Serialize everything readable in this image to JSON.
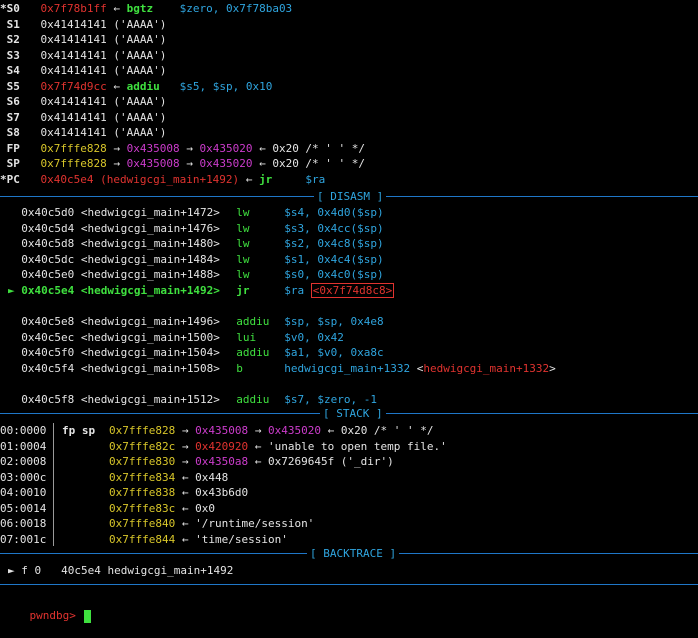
{
  "registers": [
    {
      "name": "*S0",
      "value": "0x7f78b1ff",
      "vcolor": "red",
      "rest": [
        {
          "t": " ← ",
          "c": "white"
        },
        {
          "t": "bgtz",
          "c": "green"
        },
        {
          "t": "    $zero, 0x7f78ba03",
          "c": "cyan"
        }
      ]
    },
    {
      "name": " S1",
      "value": "0x41414141 ('AAAA')",
      "vcolor": "white",
      "rest": []
    },
    {
      "name": " S2",
      "value": "0x41414141 ('AAAA')",
      "vcolor": "white",
      "rest": []
    },
    {
      "name": " S3",
      "value": "0x41414141 ('AAAA')",
      "vcolor": "white",
      "rest": []
    },
    {
      "name": " S4",
      "value": "0x41414141 ('AAAA')",
      "vcolor": "white",
      "rest": []
    },
    {
      "name": " S5",
      "value": "0x7f74d9cc",
      "vcolor": "red",
      "rest": [
        {
          "t": " ← ",
          "c": "white"
        },
        {
          "t": "addiu",
          "c": "green"
        },
        {
          "t": "   $s5, $sp, 0x10",
          "c": "cyan"
        }
      ]
    },
    {
      "name": " S6",
      "value": "0x41414141 ('AAAA')",
      "vcolor": "white",
      "rest": []
    },
    {
      "name": " S7",
      "value": "0x41414141 ('AAAA')",
      "vcolor": "white",
      "rest": []
    },
    {
      "name": " S8",
      "value": "0x41414141 ('AAAA')",
      "vcolor": "white",
      "rest": []
    },
    {
      "name": " FP",
      "value": "0x7fffe828",
      "vcolor": "yellow",
      "rest": [
        {
          "t": " → ",
          "c": "white"
        },
        {
          "t": "0x435008",
          "c": "magenta"
        },
        {
          "t": " → ",
          "c": "white"
        },
        {
          "t": "0x435020",
          "c": "magenta"
        },
        {
          "t": " ← 0x20 /* ' ' */",
          "c": "white"
        }
      ]
    },
    {
      "name": " SP",
      "value": "0x7fffe828",
      "vcolor": "yellow",
      "rest": [
        {
          "t": " → ",
          "c": "white"
        },
        {
          "t": "0x435008",
          "c": "magenta"
        },
        {
          "t": " → ",
          "c": "white"
        },
        {
          "t": "0x435020",
          "c": "magenta"
        },
        {
          "t": " ← 0x20 /* ' ' */",
          "c": "white"
        }
      ]
    },
    {
      "name": "*PC",
      "value": "0x40c5e4 (hedwigcgi_main+1492)",
      "vcolor": "red",
      "rest": [
        {
          "t": " ← ",
          "c": "white"
        },
        {
          "t": "jr",
          "c": "green"
        },
        {
          "t": "     $ra",
          "c": "cyan"
        }
      ]
    }
  ],
  "sections": {
    "disasm": "[ DISASM ]",
    "stack": "[ STACK ]",
    "backtrace": "[ BACKTRACE ]"
  },
  "disasm": [
    {
      "marker": "  ",
      "addr": "0x40c5d0 <hedwigcgi_main+1472>",
      "mn": "lw",
      "ops": "$s4, 0x4d0($sp)",
      "current": false
    },
    {
      "marker": "  ",
      "addr": "0x40c5d4 <hedwigcgi_main+1476>",
      "mn": "lw",
      "ops": "$s3, 0x4cc($sp)",
      "current": false
    },
    {
      "marker": "  ",
      "addr": "0x40c5d8 <hedwigcgi_main+1480>",
      "mn": "lw",
      "ops": "$s2, 0x4c8($sp)",
      "current": false
    },
    {
      "marker": "  ",
      "addr": "0x40c5dc <hedwigcgi_main+1484>",
      "mn": "lw",
      "ops": "$s1, 0x4c4($sp)",
      "current": false
    },
    {
      "marker": "  ",
      "addr": "0x40c5e0 <hedwigcgi_main+1488>",
      "mn": "lw",
      "ops": "$s0, 0x4c0($sp)",
      "current": false
    },
    {
      "marker": "► ",
      "addr": "0x40c5e4 <hedwigcgi_main+1492>",
      "mn": "jr",
      "ops": "$ra ",
      "target": "<0x7f74d8c8>",
      "current": true
    },
    {
      "marker": "",
      "addr": "",
      "mn": "",
      "ops": "",
      "current": false
    },
    {
      "marker": "  ",
      "addr": "0x40c5e8 <hedwigcgi_main+1496>",
      "mn": "addiu",
      "ops": "$sp, $sp, 0x4e8",
      "current": false
    },
    {
      "marker": "  ",
      "addr": "0x40c5ec <hedwigcgi_main+1500>",
      "mn": "lui",
      "ops": "$v0, 0x42",
      "current": false
    },
    {
      "marker": "  ",
      "addr": "0x40c5f0 <hedwigcgi_main+1504>",
      "mn": "addiu",
      "ops": "$a1, $v0, 0xa8c",
      "current": false
    },
    {
      "marker": "  ",
      "addr": "0x40c5f4 <hedwigcgi_main+1508>",
      "mn": "b",
      "ops": "hedwigcgi_main+1332 ",
      "target2": "<hedwigcgi_main+1332>",
      "current": false
    },
    {
      "marker": "",
      "addr": "",
      "mn": "",
      "ops": "",
      "current": false
    },
    {
      "marker": "  ",
      "addr": "0x40c5f8 <hedwigcgi_main+1512>",
      "mn": "addiu",
      "ops": "$s7, $zero, -1",
      "current": false
    }
  ],
  "stack": [
    {
      "idx": "00:0000",
      "label": "fp sp",
      "addr": "0x7fffe828",
      "chain": [
        {
          "t": " → ",
          "c": "white"
        },
        {
          "t": "0x435008",
          "c": "magenta"
        },
        {
          "t": " → ",
          "c": "white"
        },
        {
          "t": "0x435020",
          "c": "magenta"
        },
        {
          "t": " ← 0x20 /* ' ' */",
          "c": "white"
        }
      ]
    },
    {
      "idx": "01:0004",
      "label": "",
      "addr": "0x7fffe82c",
      "chain": [
        {
          "t": " → ",
          "c": "white"
        },
        {
          "t": "0x420920",
          "c": "red"
        },
        {
          "t": " ← 'unable to open temp file.'",
          "c": "white"
        }
      ]
    },
    {
      "idx": "02:0008",
      "label": "",
      "addr": "0x7fffe830",
      "chain": [
        {
          "t": " → ",
          "c": "white"
        },
        {
          "t": "0x4350a8",
          "c": "magenta"
        },
        {
          "t": " ← 0x7269645f ('_dir')",
          "c": "white"
        }
      ]
    },
    {
      "idx": "03:000c",
      "label": "",
      "addr": "0x7fffe834",
      "chain": [
        {
          "t": " ← 0x448",
          "c": "white"
        }
      ]
    },
    {
      "idx": "04:0010",
      "label": "",
      "addr": "0x7fffe838",
      "chain": [
        {
          "t": " ← 0x43b6d0",
          "c": "white"
        }
      ]
    },
    {
      "idx": "05:0014",
      "label": "",
      "addr": "0x7fffe83c",
      "chain": [
        {
          "t": " ← 0x0",
          "c": "white"
        }
      ]
    },
    {
      "idx": "06:0018",
      "label": "",
      "addr": "0x7fffe840",
      "chain": [
        {
          "t": " ← '/runtime/session'",
          "c": "white"
        }
      ]
    },
    {
      "idx": "07:001c",
      "label": "",
      "addr": "0x7fffe844",
      "chain": [
        {
          "t": " ← 'time/session'",
          "c": "white"
        }
      ]
    }
  ],
  "backtrace": [
    {
      "marker": "► f 0",
      "addr": "40c5e4",
      "sym": "hedwigcgi_main+1492"
    }
  ],
  "prompt": "pwndbg>",
  "colors": {
    "red": "#e0332f",
    "yellow": "#d8c62a",
    "magenta": "#cc3ccc",
    "green": "#3fe03f",
    "cyan": "#2fa5df",
    "rule": "#1f77c8"
  }
}
